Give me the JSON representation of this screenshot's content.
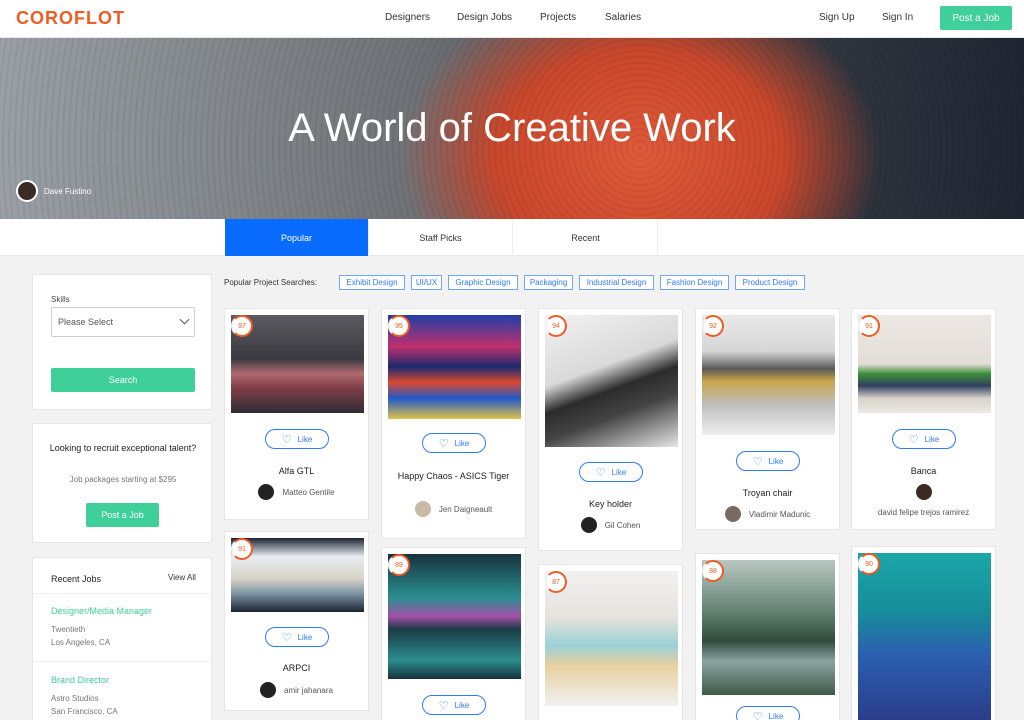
{
  "header": {
    "brand": "COROFLOT",
    "nav": [
      "Designers",
      "Design Jobs",
      "Projects",
      "Salaries"
    ],
    "sign_up": "Sign Up",
    "sign_in": "Sign In",
    "post_job": "Post a Job"
  },
  "hero": {
    "title": "A World of Creative Work",
    "credit": "Dave Fustino"
  },
  "tabs": [
    "Popular",
    "Staff Picks",
    "Recent"
  ],
  "sidebar": {
    "skills_label": "Skills",
    "skills_placeholder": "Please Select",
    "search_button": "Search",
    "recruit_heading": "Looking to recruit exceptional talent?",
    "recruit_sub": "Job packages starting at $295",
    "recruit_button": "Post a Job",
    "recent_jobs_title": "Recent Jobs",
    "view_all": "View All",
    "jobs": [
      {
        "title": "Designer/Media Manager",
        "company": "Twentieth",
        "location": "Los Angeles, CA"
      },
      {
        "title": "Brand Director",
        "company": "Astro Studios",
        "location": "San Francisco, CA"
      }
    ]
  },
  "popular_searches": {
    "label": "Popular Project Searches:",
    "chips": [
      "Exhibit Design",
      "UI/UX",
      "Graphic Design",
      "Packaging",
      "Industrial Design",
      "Fashion Design",
      "Product Design"
    ]
  },
  "like_label": "Like",
  "projects": [
    {
      "score": "97",
      "title": "Alfa GTL",
      "author": "Matteo Gentile"
    },
    {
      "score": "95",
      "title": "Happy Chaos - ASICS Tiger",
      "author": "Jen Daigneault"
    },
    {
      "score": "94",
      "title": "Key holder",
      "author": "Gil Cohen"
    },
    {
      "score": "92",
      "title": "Troyan chair",
      "author": "Vladimir Madunic"
    },
    {
      "score": "91",
      "title": "Banca",
      "author": "david felipe trejos ramirez"
    },
    {
      "score": "91",
      "title": "ARPCI",
      "author": "amir jahanara"
    },
    {
      "score": "89",
      "title": "",
      "author": ""
    },
    {
      "score": "87",
      "title": "",
      "author": ""
    },
    {
      "score": "88",
      "title": "",
      "author": ""
    },
    {
      "score": "90",
      "title": "",
      "author": ""
    }
  ]
}
